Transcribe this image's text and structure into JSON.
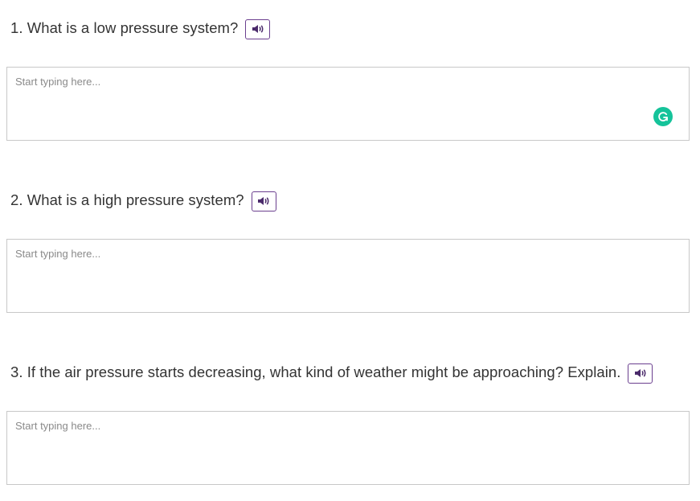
{
  "questions": [
    {
      "prompt": "1. What is a low pressure system?",
      "audio_icon": "speaker-icon",
      "answer": {
        "value": "",
        "placeholder": "Start typing here..."
      },
      "has_grammarly": true
    },
    {
      "prompt": "2. What is a high pressure system?",
      "audio_icon": "speaker-icon",
      "answer": {
        "value": "",
        "placeholder": "Start typing here..."
      },
      "has_grammarly": false
    },
    {
      "prompt": "3. If the air pressure starts decreasing, what kind of weather might be approaching? Explain.",
      "audio_icon": "speaker-icon",
      "answer": {
        "value": "",
        "placeholder": "Start typing here..."
      },
      "has_grammarly": false
    }
  ],
  "colors": {
    "audio_button_border": "#6b3f8f",
    "audio_icon": "#4b2b6b",
    "grammarly": "#15c39a",
    "text": "#333333",
    "placeholder": "#8a8a8a",
    "input_border": "#c8c8c8"
  }
}
